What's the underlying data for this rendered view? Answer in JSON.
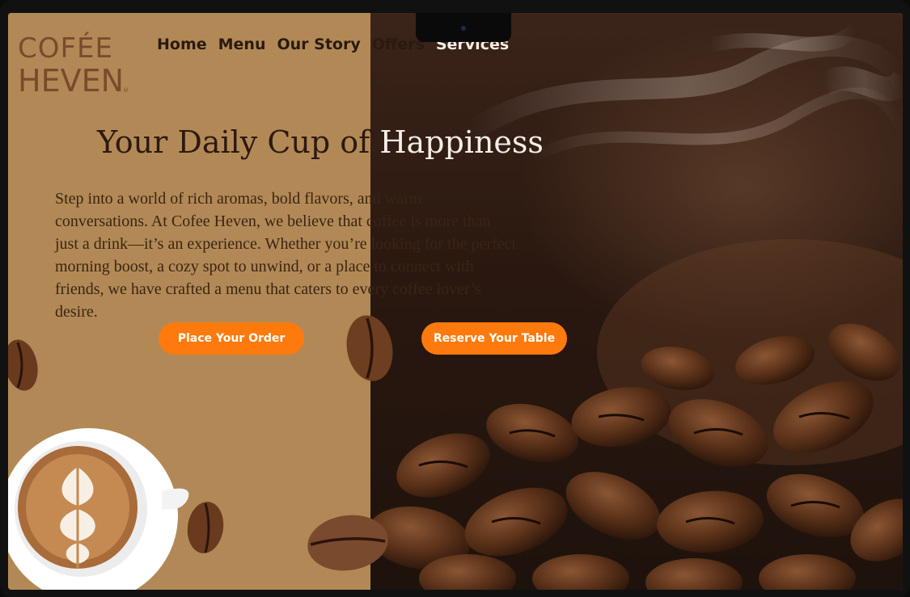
{
  "brand": {
    "logo_line1": "COFÉE",
    "logo_line2": "HEVEN",
    "registered": "®"
  },
  "nav": {
    "items": [
      {
        "label": "Home"
      },
      {
        "label": "Menu"
      },
      {
        "label": "Our Story"
      },
      {
        "label": "Offers"
      },
      {
        "label": "Services"
      }
    ]
  },
  "hero": {
    "title_part1": "Your Daily Cup of ",
    "title_part2": "Happiness",
    "body": "Step into a world of rich aromas, bold flavors, and warm conversations. At Cofee Heven, we believe that coffee is more than just a drink—it’s an experience.  Whether you’re looking for the perfect morning boost, a cozy spot  to unwind, or a place to connect with friends, we have crafted a menu that caters to every coffee lover’s desire.",
    "order_button": "Place Your Order",
    "reserve_button": "Reserve Your Table"
  },
  "colors": {
    "left_panel": "#b28956",
    "accent_button": "#ff7a0c",
    "dark_text": "#2b1a10",
    "light_text": "#f6eee6",
    "logo": "#7a4a2e"
  },
  "icons": [
    "coffee-bean-icon",
    "coffee-cup-latte-art",
    "camera-icon"
  ]
}
